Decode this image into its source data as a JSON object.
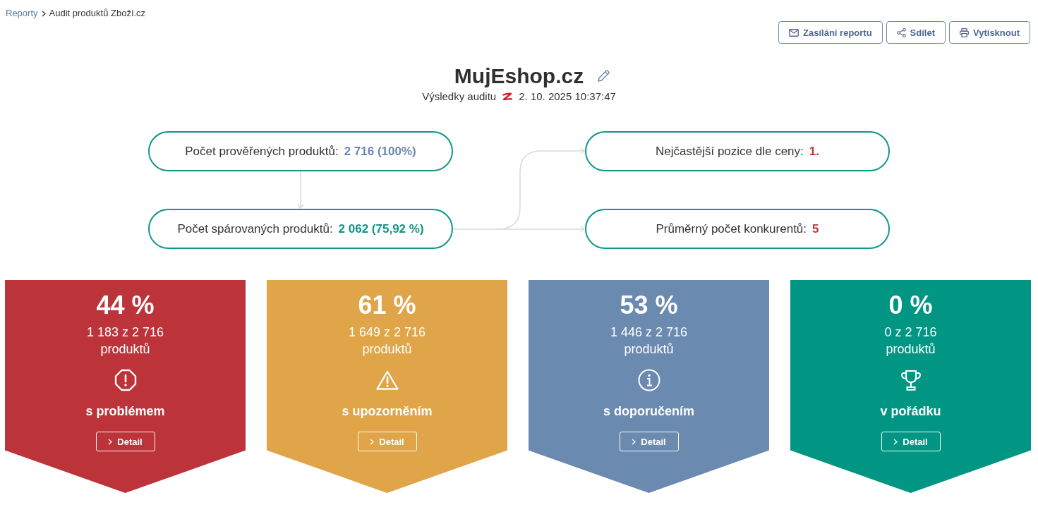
{
  "breadcrumb": [
    {
      "label": "Reporty",
      "kind": "link"
    },
    {
      "label": "Audit produktů Zboží.cz",
      "kind": "current"
    }
  ],
  "actions": [
    {
      "label": "Zasílání reportu",
      "kind": "mail"
    },
    {
      "label": "Sdílet",
      "kind": "share"
    },
    {
      "label": "Vytisknout",
      "kind": "print"
    }
  ],
  "header": {
    "title": "MujEshop.cz",
    "subtitle": "Výsledky auditu",
    "date": "2. 10. 2025 10:37:47"
  },
  "flow": {
    "nodes": [
      {
        "label": "Počet prověřených produktů:",
        "value": "2 716 (100%)",
        "color": "#6b88b0"
      },
      {
        "label": "Nejčastější pozice dle ceny:",
        "value": "1.",
        "color": "#b8393d"
      },
      {
        "label": "Počet spárovaných produktů:",
        "value": "2 062 (75,92 %)",
        "color": "#0f9484"
      },
      {
        "label": "Průměrný počet konkurentů:",
        "value": "5",
        "color": "#b8393d"
      }
    ]
  },
  "cards": [
    {
      "kind": "problem",
      "color": "#bc3439",
      "percent": "44 %",
      "count": "1 183 z 2 716",
      "unit": "produktů",
      "label": "s problémem",
      "button": "Detail"
    },
    {
      "kind": "warning",
      "color": "#e0a548",
      "percent": "61 %",
      "count": "1 649 z 2 716",
      "unit": "produktů",
      "label": "s upozorněním",
      "button": "Detail"
    },
    {
      "kind": "info",
      "color": "#6b8ab0",
      "percent": "53 %",
      "count": "1 446 z 2 716",
      "unit": "produktů",
      "label": "s doporučením",
      "button": "Detail"
    },
    {
      "kind": "ok",
      "color": "#009683",
      "percent": "0 %",
      "count": "0 z 2 716",
      "unit": "produktů",
      "label": "v pořádku",
      "button": "Detail"
    }
  ]
}
